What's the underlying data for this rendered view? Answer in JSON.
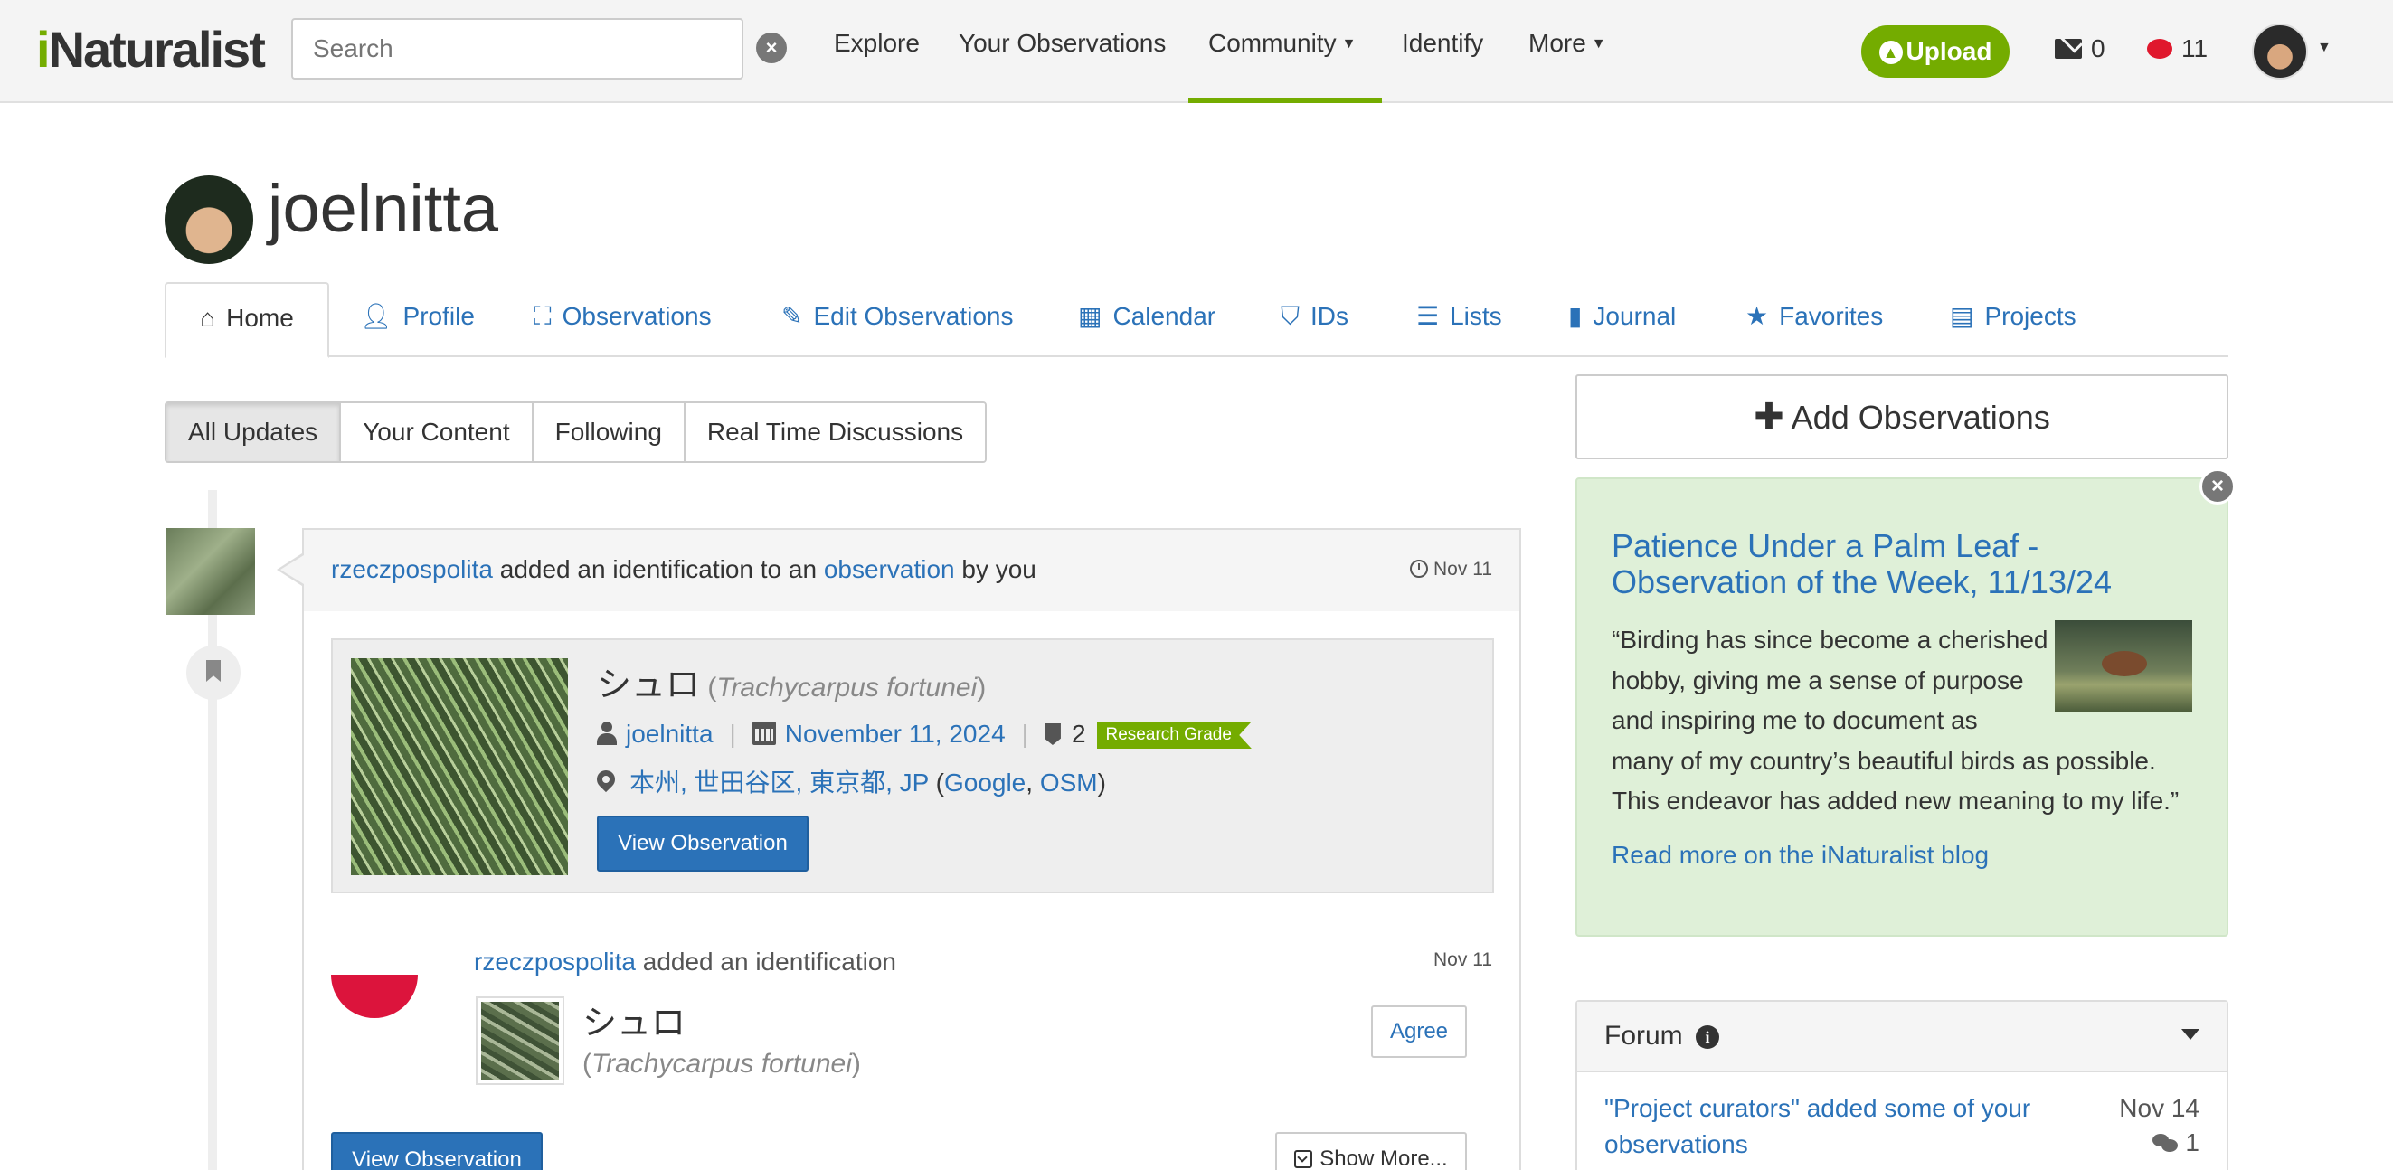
{
  "header": {
    "logo_i": "i",
    "logo_rest": "Naturalist",
    "search_placeholder": "Search",
    "nav": {
      "explore": "Explore",
      "your_observations": "Your Observations",
      "community": "Community",
      "identify": "Identify",
      "more": "More"
    },
    "upload_label": "Upload",
    "messages_count": "0",
    "notifications_count": "11",
    "active_nav": "Community"
  },
  "profile": {
    "username": "joelnitta",
    "tabs": {
      "home": "Home",
      "profile": "Profile",
      "observations": "Observations",
      "edit_observations": "Edit Observations",
      "calendar": "Calendar",
      "ids": "IDs",
      "lists": "Lists",
      "journal": "Journal",
      "favorites": "Favorites",
      "projects": "Projects"
    }
  },
  "filters": {
    "all_updates": "All Updates",
    "your_content": "Your Content",
    "following": "Following",
    "realtime": "Real Time Discussions",
    "active": "All Updates"
  },
  "feed": {
    "header": {
      "actor": "rzeczpospolita",
      "text1": " added an identification to an ",
      "obs_link": "observation",
      "text2": " by you",
      "date": "Nov 11"
    },
    "observation": {
      "common_name": "シュロ",
      "paren_open": " (",
      "scientific_name": "Trachycarpus fortunei",
      "paren_close": ")",
      "user": "joelnitta",
      "date": "November 11, 2024",
      "id_count": "2",
      "quality": "Research Grade",
      "place": "本州, 世田谷区, 東京都, JP",
      "map_open": " (",
      "google": "Google",
      "comma": ", ",
      "osm": "OSM",
      "map_close": ")",
      "view_button": "View Observation"
    },
    "identification": {
      "user": "rzeczpospolita",
      "text": " added an identification",
      "date": "Nov 11",
      "common_name": "シュロ",
      "sci_open": "(",
      "scientific_name": "Trachycarpus fortunei",
      "sci_close": ")",
      "agree": "Agree",
      "view_button": "View Observation",
      "show_more": "Show More..."
    }
  },
  "sidebar": {
    "add_observations": "Add Observations",
    "otw": {
      "title": "Patience Under a Palm Leaf - Observation of the Week, 11/13/24",
      "lines": [
        "“Birding has since become a cherished",
        "hobby, giving me a sense of purpose",
        "and inspiring me to document as",
        "many of my country’s beautiful birds as possible.",
        "This endeavor has added new meaning to my life.”"
      ],
      "link": "Read more on the iNaturalist blog"
    },
    "forum": {
      "title": "Forum",
      "post_title": "\"Project curators\" added some of your observations",
      "post_date": "Nov 14",
      "post_replies": "1"
    }
  },
  "colors": {
    "brand_green": "#74ac00",
    "link_blue": "#2b72b8",
    "otw_bg": "#dff0d8"
  }
}
